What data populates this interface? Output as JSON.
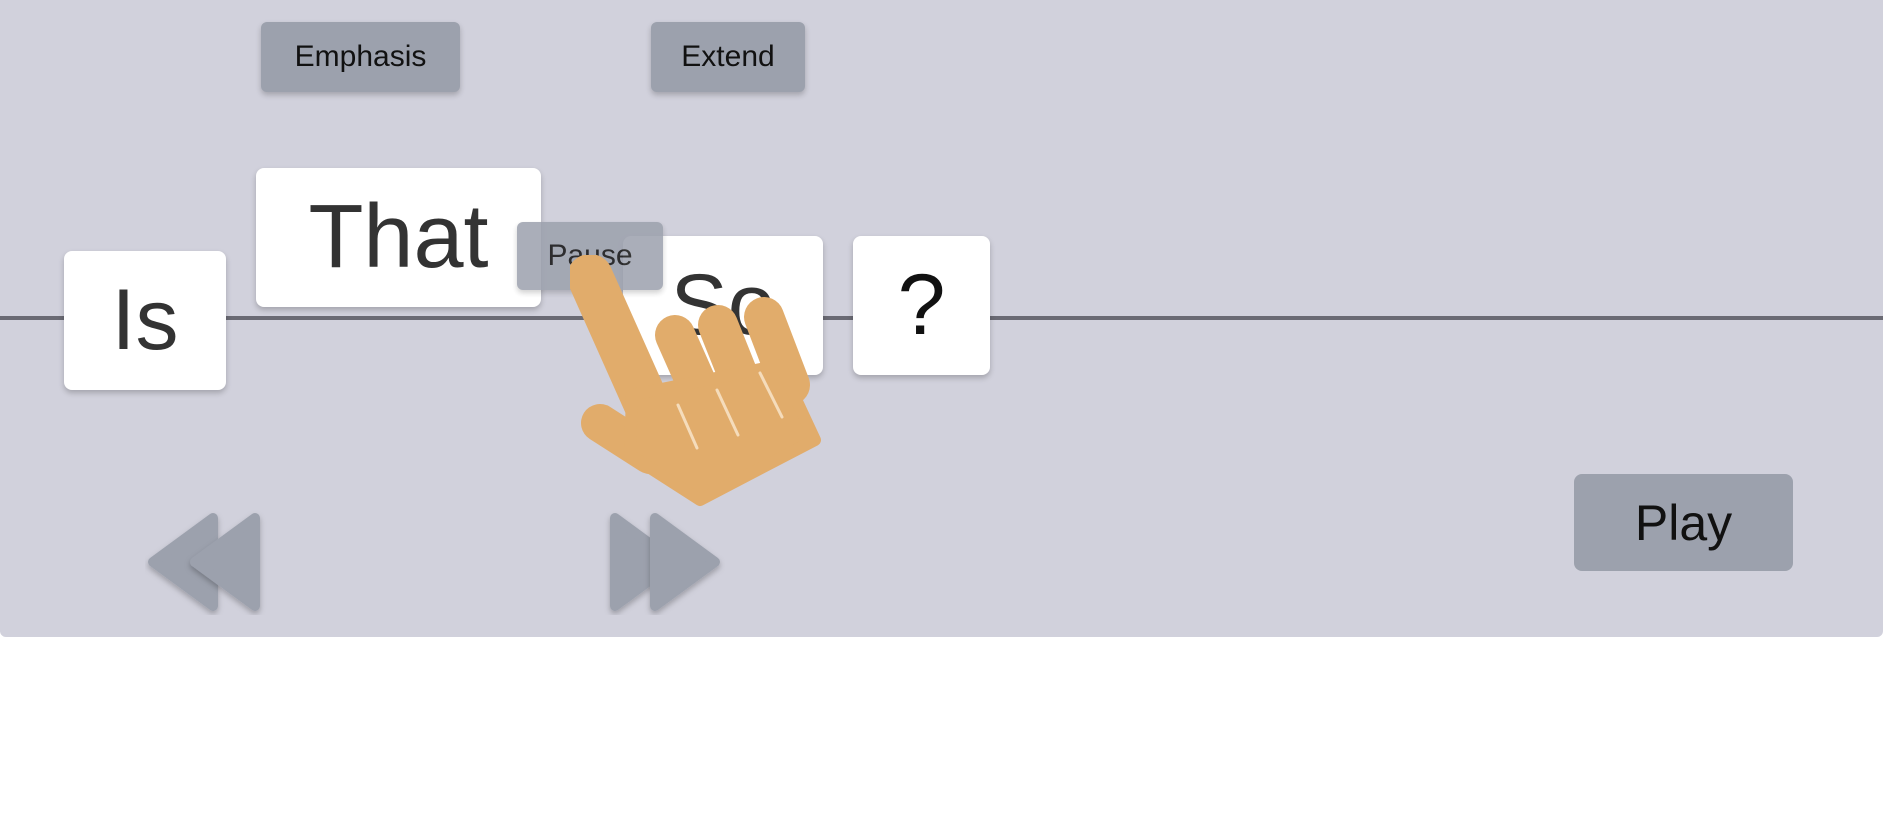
{
  "toolbar": {
    "emphasis_label": "Emphasis",
    "extend_label": "Extend",
    "pause_label": "Pause"
  },
  "words": [
    {
      "text": "Is"
    },
    {
      "text": "That"
    },
    {
      "text": "So"
    },
    {
      "text": "?"
    }
  ],
  "controls": {
    "play_label": "Play",
    "rewind_icon": "rewind-icon",
    "fast_forward_icon": "fast-forward-icon"
  },
  "overlay": {
    "cursor_icon": "pointing-hand-icon"
  },
  "colors": {
    "panel_bg": "#d1d1dc",
    "button_bg": "#9ca1ad",
    "card_bg": "#ffffff",
    "baseline": "#6a6a74",
    "hand": "#e1ac6b"
  }
}
